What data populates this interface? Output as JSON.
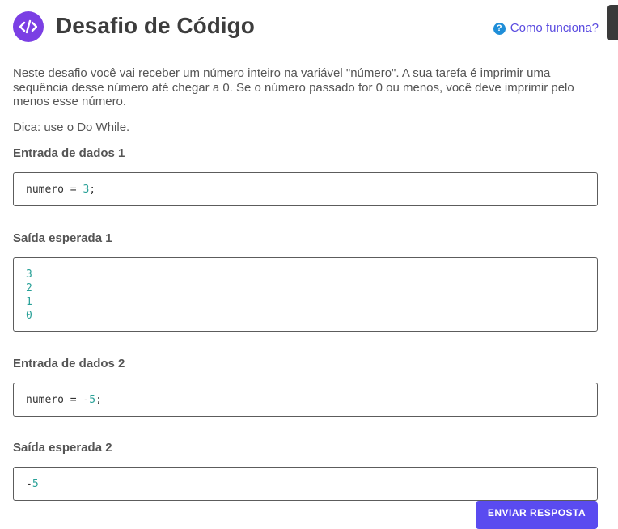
{
  "header": {
    "logo_icon": "code-icon",
    "title": "Desafio de Código",
    "help_icon": "question-circle-icon",
    "help_label": "Como funciona?"
  },
  "description": "Neste desafio você vai receber um número inteiro na variável \"número\". A sua tarefa é imprimir uma sequência desse número até chegar a 0. Se o número passado for 0 ou menos, você deve imprimir pelo menos esse número.",
  "tip": "Dica: use o Do While.",
  "examples": [
    {
      "input_label": "Entrada de dados 1",
      "input": {
        "var": "numero",
        "op": " = ",
        "value": "3",
        "end": ";"
      },
      "output_label": "Saída esperada 1",
      "output": [
        "3",
        "2",
        "1",
        "0"
      ]
    },
    {
      "input_label": "Entrada de dados 2",
      "input": {
        "var": "numero",
        "op": " = ",
        "sign": "-",
        "value": "5",
        "end": ";"
      },
      "output_label": "Saída esperada 2",
      "output_sign": "-",
      "output_value": "5"
    }
  ],
  "submit_label": "ENVIAR RESPOSTA",
  "colors": {
    "accent": "#7b3fe4",
    "link": "#5a4be0",
    "number": "#2aa198",
    "button": "#5a4bf0"
  }
}
